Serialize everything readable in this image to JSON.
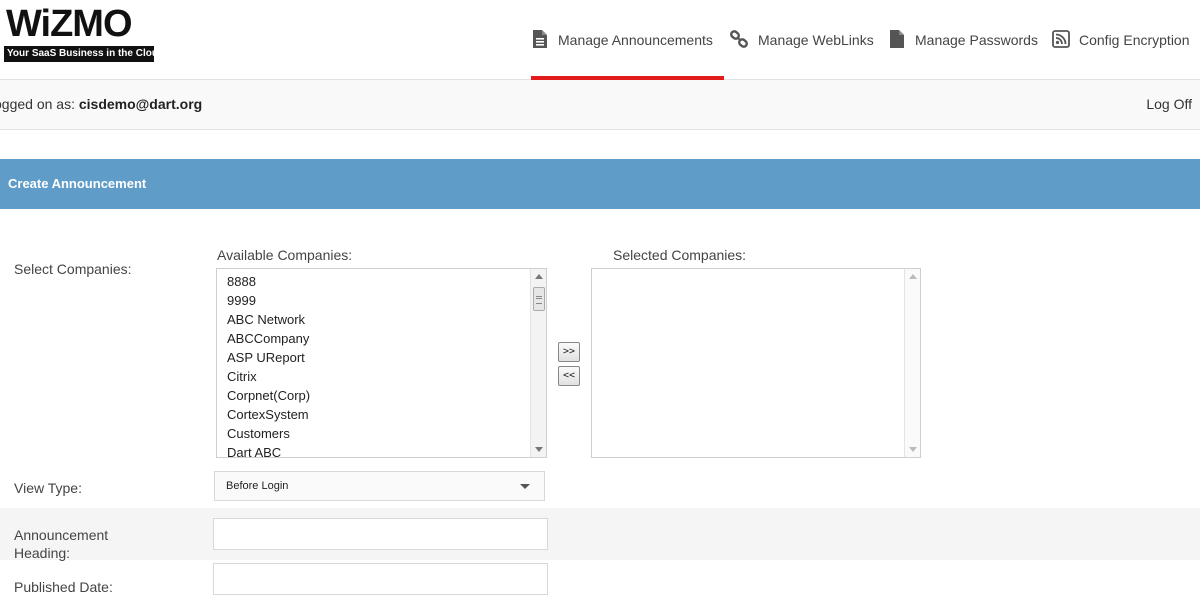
{
  "brand": {
    "name": "WiZMO",
    "tagline": "Your SaaS Business in the Cloud"
  },
  "nav": [
    {
      "label": "Manage Announcements",
      "icon": "document-icon",
      "active": true
    },
    {
      "label": "Manage WebLinks",
      "icon": "link-icon",
      "active": false
    },
    {
      "label": "Manage Passwords",
      "icon": "document-icon",
      "active": false
    },
    {
      "label": "Config Encryption",
      "icon": "rss-icon",
      "active": false
    }
  ],
  "userbar": {
    "logged_prefix": "ogged on as: ",
    "user": "cisdemo@dart.org",
    "logoff": "Log Off"
  },
  "section": {
    "title": "Create Announcement"
  },
  "form": {
    "select_companies_label": "Select Companies:",
    "available_label": "Available Companies:",
    "selected_label": "Selected Companies:",
    "available_companies": [
      "8888",
      "9999",
      "ABC Network",
      "ABCCompany",
      "ASP UReport",
      "Citrix",
      "Corpnet(Corp)",
      "CortexSystem",
      "Customers",
      "Dart ABC"
    ],
    "selected_companies": [],
    "add_button": ">>",
    "remove_button": "<<",
    "view_type_label": "View Type:",
    "view_type_value": "Before Login",
    "heading_label": "Announcement Heading:",
    "heading_value": "",
    "published_label": "Published Date:",
    "published_value": ""
  },
  "colors": {
    "accent": "#e31b1b",
    "section_bg": "#5f9cc7"
  }
}
